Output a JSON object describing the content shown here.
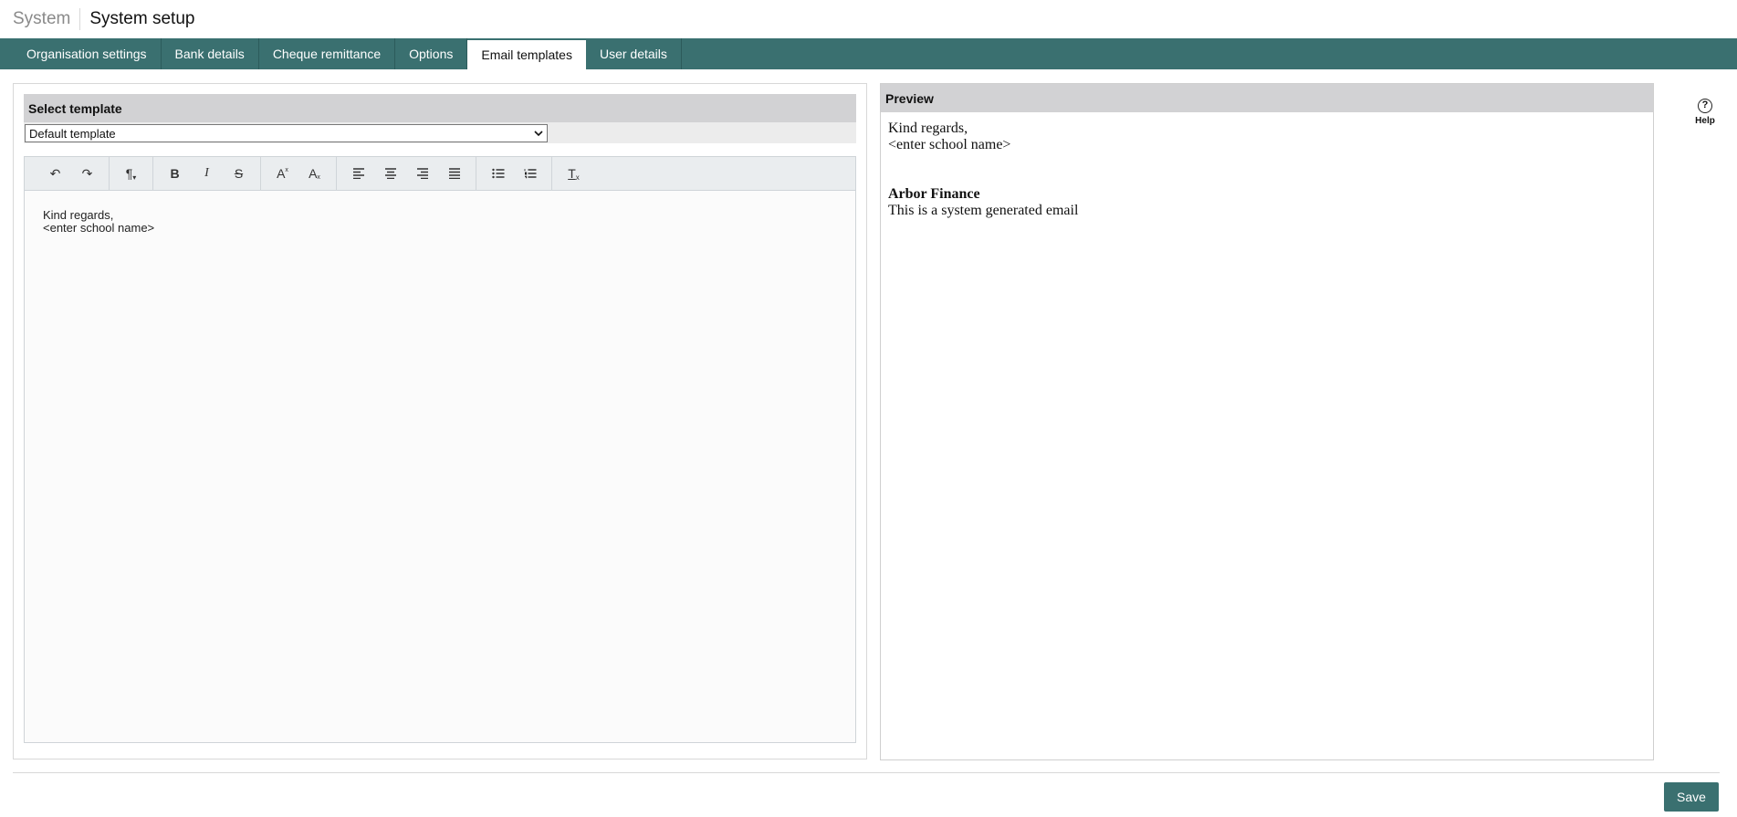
{
  "header": {
    "root": "System",
    "title": "System setup"
  },
  "tabs": [
    {
      "label": "Organisation settings"
    },
    {
      "label": "Bank details"
    },
    {
      "label": "Cheque remittance"
    },
    {
      "label": "Options"
    },
    {
      "label": "Email templates"
    },
    {
      "label": "User details"
    }
  ],
  "active_tab": "Email templates",
  "template": {
    "heading": "Select template",
    "selected": "Default template"
  },
  "toolbar": {
    "undo": "↶",
    "redo": "↷",
    "paragraph": "¶",
    "bold": "B",
    "italic": "I",
    "strike": "S",
    "superscript": "A",
    "subscript": "A",
    "clear_format": "T"
  },
  "editor": {
    "line1": "Kind regards,",
    "line2": "<enter school name>"
  },
  "preview": {
    "heading": "Preview",
    "line1": "Kind regards,",
    "line2": "<enter school name>",
    "brand": "Arbor Finance",
    "footer": "This is a system generated email"
  },
  "help": {
    "icon": "?",
    "label": "Help"
  },
  "actions": {
    "save": "Save"
  },
  "colors": {
    "accent": "#3a7070",
    "panel_header": "#d2d2d4"
  }
}
